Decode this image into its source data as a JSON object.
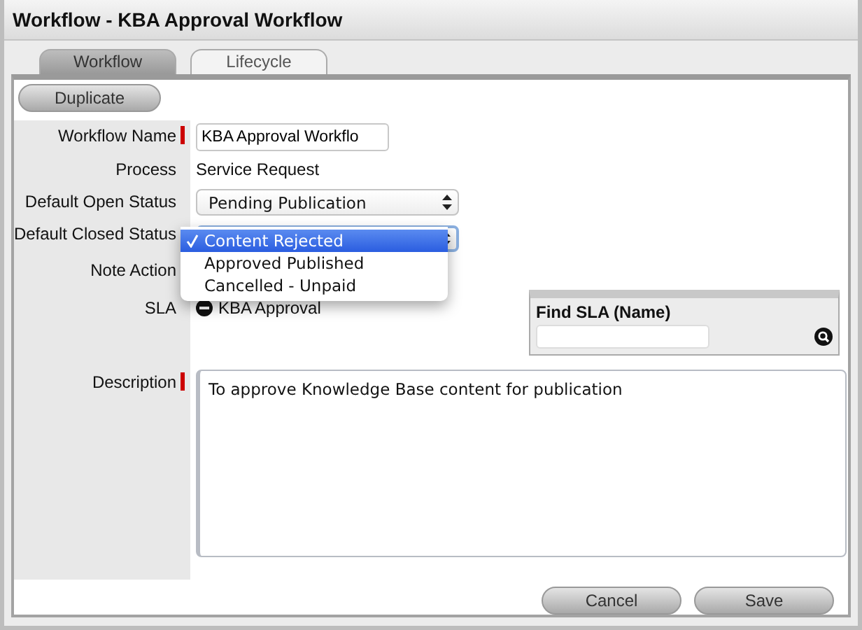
{
  "window": {
    "title": "Workflow - KBA Approval Workflow"
  },
  "tabs": [
    {
      "label": "Workflow",
      "selected": true
    },
    {
      "label": "Lifecycle",
      "selected": false
    }
  ],
  "toolbar": {
    "button": "Duplicate"
  },
  "form": {
    "workflow_name": {
      "label": "Workflow Name",
      "required": true,
      "value": "KBA Approval Workflo"
    },
    "process": {
      "label": "Process",
      "value": "Service Request"
    },
    "default_open_status": {
      "label": "Default Open Status",
      "value": "Pending Publication"
    },
    "default_closed_status": {
      "label": "Default Closed Status",
      "menu": [
        {
          "label": "Content Rejected",
          "selected": true
        },
        {
          "label": "Approved Published",
          "selected": false
        },
        {
          "label": "Cancelled - Unpaid",
          "selected": false
        }
      ]
    },
    "note_action": {
      "label": "Note Action"
    },
    "sla": {
      "label": "SLA",
      "value": "KBA Approval"
    },
    "find_sla": {
      "label": "Find SLA (Name)"
    },
    "description": {
      "label": "Description",
      "required": true,
      "value": "To approve Knowledge Base content for publication"
    }
  },
  "buttons": [
    "Cancel",
    "Save"
  ]
}
